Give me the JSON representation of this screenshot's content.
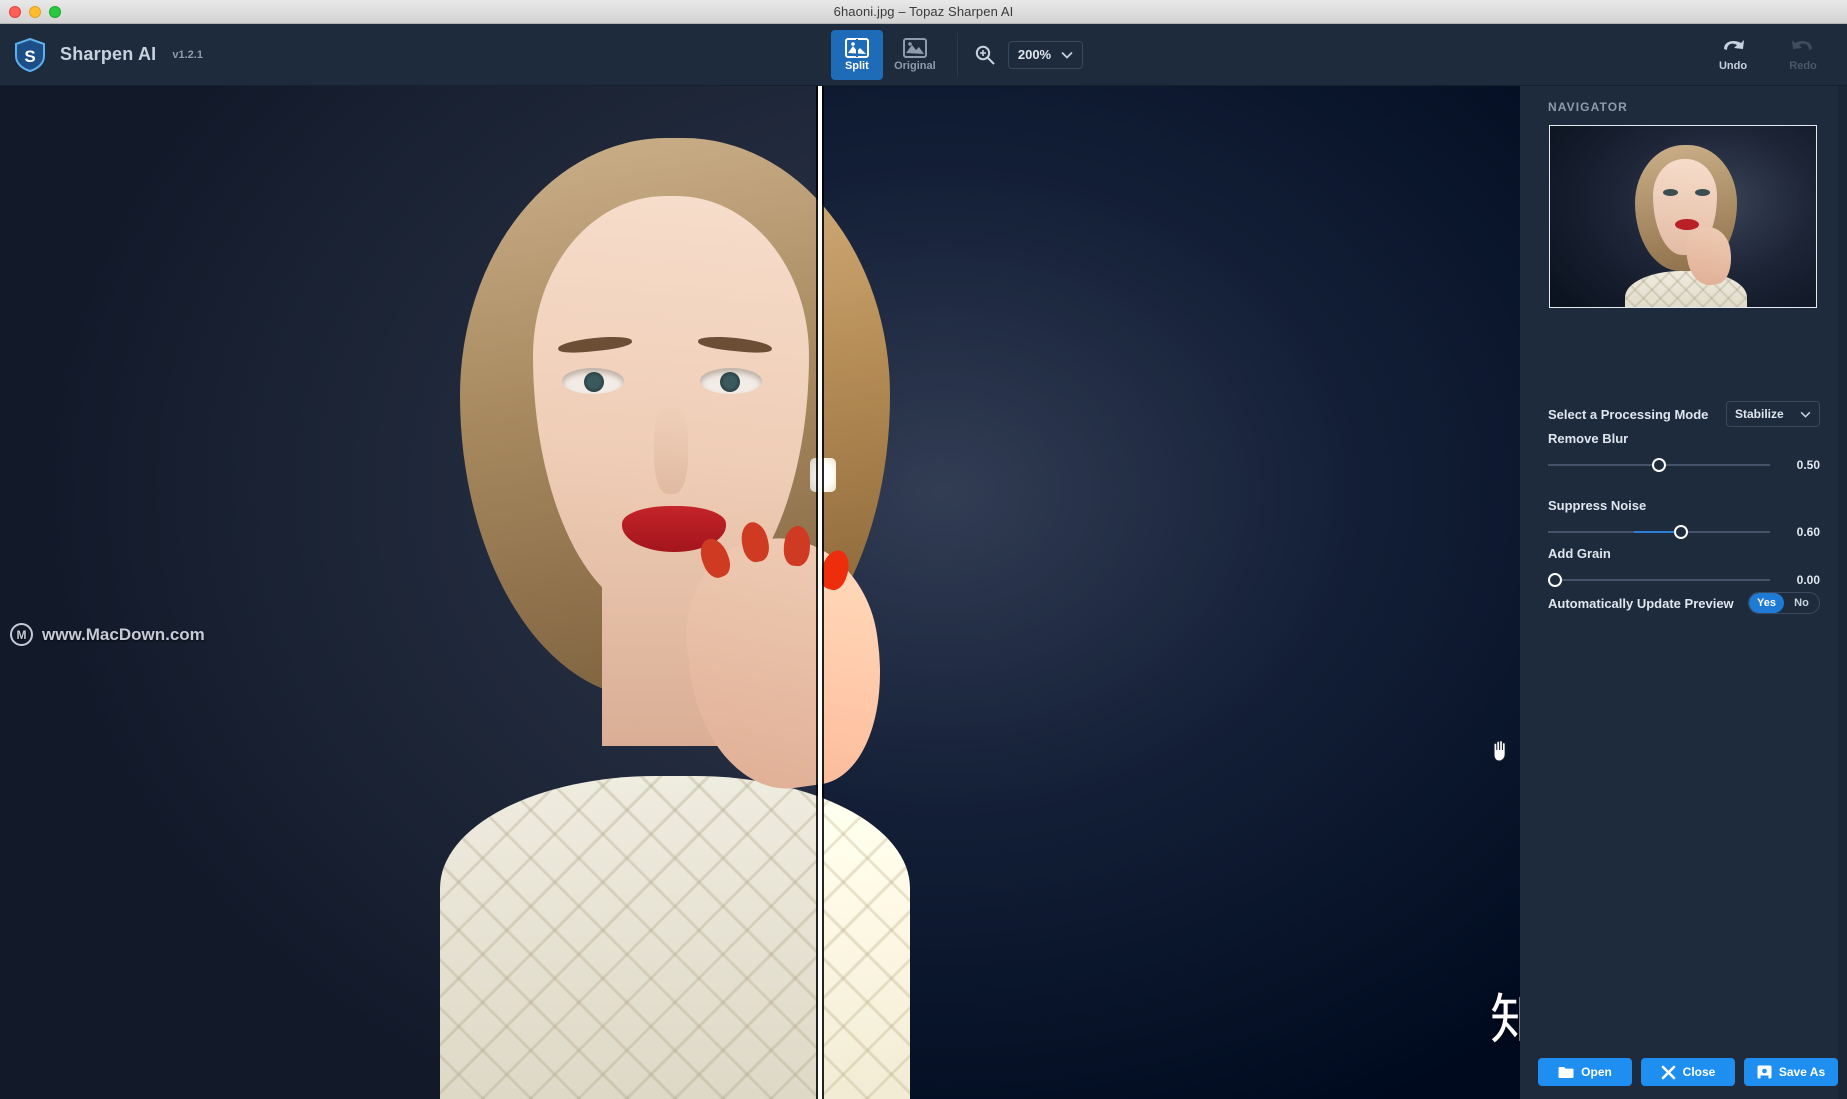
{
  "window": {
    "title": "6haoni.jpg – Topaz Sharpen AI",
    "traffic_lights": [
      "close",
      "minimize",
      "maximize"
    ]
  },
  "header": {
    "app_name": "Sharpen AI",
    "version": "v1.2.1",
    "logo_icon": "shield-s-icon",
    "view_modes": [
      {
        "label": "Split",
        "icon": "split-view-icon",
        "active": true
      },
      {
        "label": "Original",
        "icon": "original-image-icon",
        "active": false
      }
    ],
    "zoom": {
      "icon": "magnifier-plus-icon",
      "value": "200%",
      "chevron": "chevron-down-icon"
    },
    "history": [
      {
        "label": "Undo",
        "icon": "undo-arrow-icon",
        "enabled": true
      },
      {
        "label": "Redo",
        "icon": "redo-arrow-icon",
        "enabled": false
      }
    ]
  },
  "canvas": {
    "split_handle": "split-divider",
    "cursor": "hand-cursor",
    "watermark_left": "www.MacDown.com",
    "watermark_left_logo": "macdown-circle-m-icon",
    "watermark_bottom": "知乎 @小二"
  },
  "panel": {
    "navigator_title": "NAVIGATOR",
    "processing_mode": {
      "label": "Select a Processing Mode",
      "value": "Stabilize",
      "chevron": "chevron-down-icon"
    },
    "sliders": [
      {
        "label": "Remove Blur",
        "value": "0.50",
        "percent": 50,
        "filled": false
      },
      {
        "label": "Suppress Noise",
        "value": "0.60",
        "percent": 60,
        "filled": true
      },
      {
        "label": "Add Grain",
        "value": "0.00",
        "percent": 0,
        "filled": false
      }
    ],
    "auto_update": {
      "label": "Automatically Update Preview",
      "yes_label": "Yes",
      "no_label": "No",
      "selected": "Yes"
    },
    "footer_buttons": [
      {
        "label": "Open",
        "icon": "folder-icon"
      },
      {
        "label": "Close",
        "icon": "x-close-icon"
      },
      {
        "label": "Save As",
        "icon": "save-disk-icon"
      }
    ]
  },
  "colors": {
    "accent": "#1e8ef0",
    "panel_bg": "#1d2b3c",
    "canvas_bg": "#232f42",
    "active_tab": "#1e6bb8",
    "slider_fill": "#2a7fd4",
    "muted_text": "#8e9bab"
  }
}
